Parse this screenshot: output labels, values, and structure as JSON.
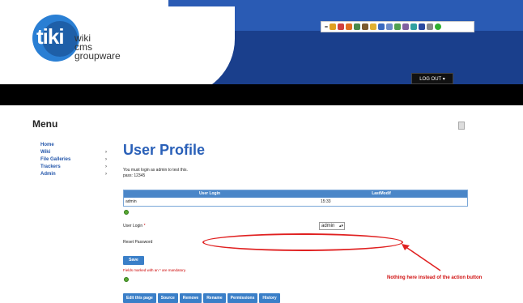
{
  "header": {
    "logo_word": "tiki",
    "logo_lines": [
      "wiki",
      "cms",
      "groupware"
    ],
    "logout_label": "LOG OUT ▾"
  },
  "toolbar": {
    "icons": [
      "arrow-icon",
      "search-icon",
      "home-icon",
      "edit-icon",
      "user-icon",
      "user-icon",
      "key-icon",
      "calendar-icon",
      "mail-icon",
      "image-icon",
      "list-icon",
      "grid-icon",
      "book-icon",
      "gear-icon",
      "green-dot-icon"
    ]
  },
  "menu": {
    "title": "Menu",
    "items": [
      {
        "label": "Home",
        "has_arrow": false
      },
      {
        "label": "Wiki",
        "has_arrow": true
      },
      {
        "label": "File Galleries",
        "has_arrow": true
      },
      {
        "label": "Trackers",
        "has_arrow": true
      },
      {
        "label": "Admin",
        "has_arrow": true
      }
    ],
    "arrow": "›"
  },
  "main": {
    "title": "User Profile",
    "message_line1": "You must login as admin to test this.",
    "message_line2": "pass: 12345",
    "table": {
      "headers": [
        "User Login",
        "LastModif"
      ],
      "rows": [
        [
          "admin",
          "15:33"
        ]
      ]
    },
    "user_login_label": "User Login",
    "required_mark": "*",
    "user_login_value": "admin",
    "reset_password_label": "Reset Password",
    "save_label": "Save",
    "mandatory_note": "Fields marked with an * are mandatory.",
    "annotation": "Nothing here instead of the action button",
    "actions": [
      "Edit this page",
      "Source",
      "Remove",
      "Rename",
      "Permissions",
      "History"
    ]
  },
  "colors": {
    "accent": "#2a60b8",
    "annotation": "#e02020"
  }
}
